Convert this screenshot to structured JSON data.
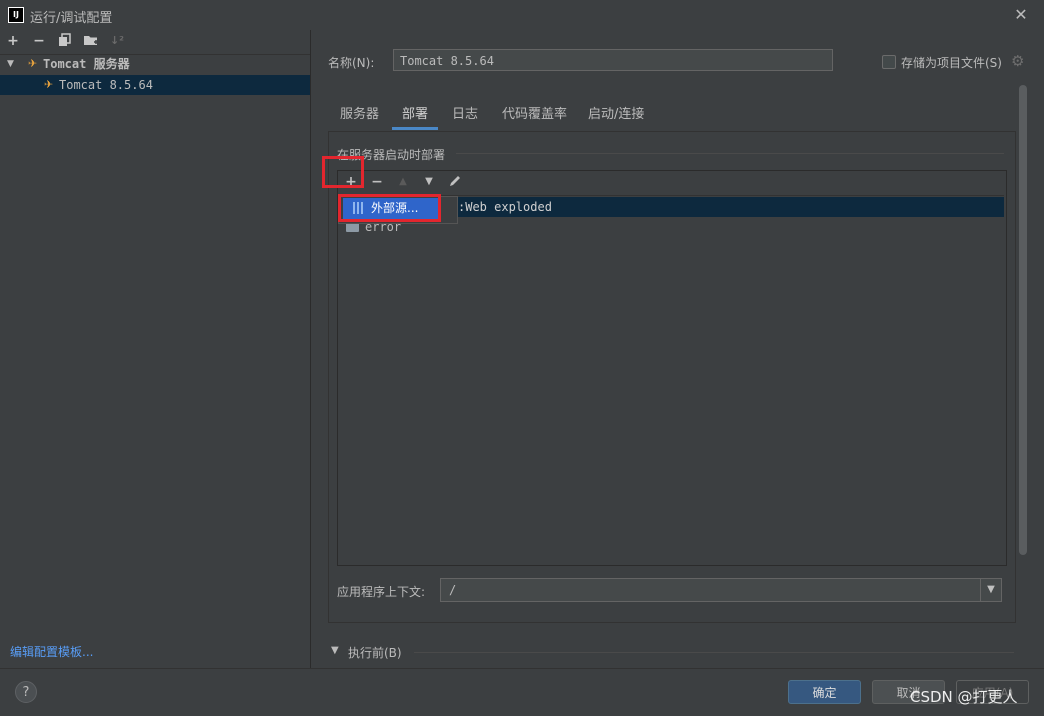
{
  "window": {
    "title": "运行/调试配置",
    "app_icon_text": "IJ"
  },
  "left_toolbar": {
    "icons": [
      "add-icon",
      "remove-icon",
      "copy-icon",
      "folder-icon",
      "sort-icon"
    ]
  },
  "tree": {
    "group_label": "Tomcat 服务器",
    "item_label": "Tomcat 8.5.64"
  },
  "edit_templates_link": "编辑配置模板...",
  "name_field": {
    "label": "名称(N):",
    "value": "Tomcat 8.5.64"
  },
  "store_as_project": {
    "label": "存储为项目文件(S)",
    "checked": false
  },
  "tabs": [
    "服务器",
    "部署",
    "日志",
    "代码覆盖率",
    "启动/连接"
  ],
  "active_tab": "部署",
  "deploy": {
    "section_title": "在服务器启动时部署",
    "rows": [
      ":Web exploded",
      "error"
    ],
    "popup_item": "外部源..."
  },
  "context": {
    "label": "应用程序上下文:",
    "value": "/"
  },
  "before_launch": {
    "label": "执行前(B)"
  },
  "buttons": {
    "ok": "确定",
    "cancel": "取消",
    "apply": "应用(A)",
    "help": "?"
  },
  "watermark": "CSDN @打更人",
  "colors": {
    "selection": "#0d293e",
    "accent": "#4a88c7",
    "highlight": "#e3262e",
    "popup_selected": "#2f65ca"
  }
}
